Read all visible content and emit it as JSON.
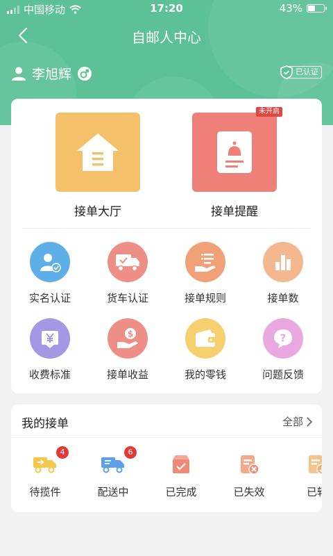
{
  "status": {
    "carrier": "中国移动",
    "time": "17:20",
    "battery": "43%"
  },
  "nav": {
    "title": "自邮人中心"
  },
  "user": {
    "name": "李旭辉",
    "verified_label": "已认证"
  },
  "main": {
    "big": [
      {
        "label": "接单大厅",
        "color": "#f5c06a"
      },
      {
        "label": "接单提醒",
        "color": "#ee7f79",
        "badge": "未开启"
      }
    ],
    "grid": [
      {
        "label": "实名认证",
        "color": "#5eaee8",
        "icon": "user-check-icon"
      },
      {
        "label": "货车认证",
        "color": "#ee8f87",
        "icon": "truck-icon"
      },
      {
        "label": "接单规则",
        "color": "#f1a177",
        "icon": "hand-list-icon"
      },
      {
        "label": "接单数",
        "color": "#f3b88d",
        "icon": "bar-chart-icon"
      },
      {
        "label": "收费标准",
        "color": "#a497e4",
        "icon": "yen-icon"
      },
      {
        "label": "接单收益",
        "color": "#ee8f87",
        "icon": "dollar-hand-icon"
      },
      {
        "label": "我的零钱",
        "color": "#f6cf6e",
        "icon": "wallet-icon"
      },
      {
        "label": "问题反馈",
        "color": "#e9a9e0",
        "icon": "question-icon"
      }
    ]
  },
  "orders": {
    "title": "我的接单",
    "all_label": "全部",
    "items": [
      {
        "label": "待揽件",
        "count": "4",
        "color": "#f2c94c",
        "icon": "truck-pickup-icon"
      },
      {
        "label": "配送中",
        "count": "6",
        "color": "#5ea0e8",
        "icon": "truck-delivery-icon"
      },
      {
        "label": "已完成",
        "color": "#ef8a77",
        "icon": "box-check-icon"
      },
      {
        "label": "已失效",
        "color": "#ef9a77",
        "icon": "doc-x-icon"
      },
      {
        "label": "已转",
        "color": "#f0b070",
        "icon": "doc-transfer-icon"
      }
    ]
  }
}
